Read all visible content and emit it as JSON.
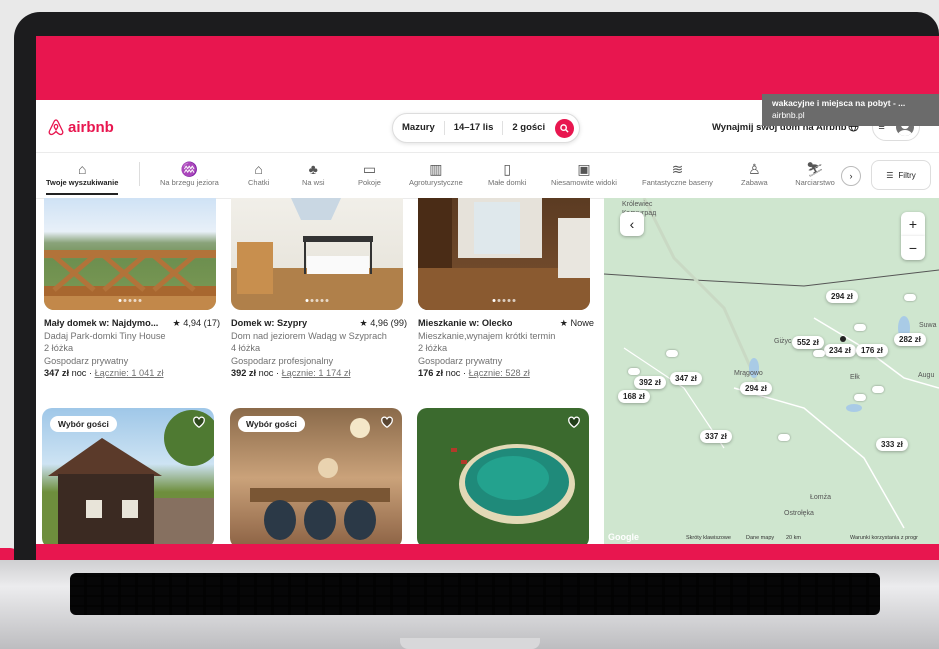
{
  "tooltip": {
    "line1": "wakacyjne i miejsca na pobyt - ...",
    "line2": "airbnb.pl"
  },
  "header": {
    "logo_text": "airbnb",
    "search": {
      "location": "Mazury",
      "dates": "14–17 lis",
      "guests": "2 gości"
    },
    "host_link": "Wynajmij swój dom na Airbnb"
  },
  "categories": [
    {
      "label": "Twoje wyszukiwanie",
      "icon": "home-search-icon",
      "active": true
    },
    {
      "label": "Na brzegu jeziora",
      "icon": "lake-icon"
    },
    {
      "label": "Chatki",
      "icon": "cabin-icon"
    },
    {
      "label": "Na wsi",
      "icon": "countryside-icon"
    },
    {
      "label": "Pokoje",
      "icon": "bed-icon"
    },
    {
      "label": "Agroturystyczne",
      "icon": "farm-icon"
    },
    {
      "label": "Małe domki",
      "icon": "tiny-home-icon"
    },
    {
      "label": "Niesamowite widoki",
      "icon": "view-icon"
    },
    {
      "label": "Fantastyczne baseny",
      "icon": "pool-icon"
    },
    {
      "label": "Zabawa",
      "icon": "play-icon"
    },
    {
      "label": "Narciarstwo",
      "icon": "ski-icon"
    }
  ],
  "filters_label": "Filtry",
  "listings": [
    {
      "title": "Mały domek w: Najdymo...",
      "rating": "★ 4,94 (17)",
      "line1": "Dadaj Park-domki Tiny House",
      "line2": "2 łóżka",
      "line3": "Gospodarz prywatny",
      "price": "347 zł",
      "price_suffix": " noc · ",
      "total": "Łącznie: 1 041 zł"
    },
    {
      "title": "Domek w: Szypry",
      "rating": "★ 4,96 (99)",
      "line1": "Dom nad jeziorem Wadąg w Szyprach",
      "line2": "4 łóżka",
      "line3": "Gospodarz profesjonalny",
      "price": "392 zł",
      "price_suffix": " noc · ",
      "total": "Łącznie: 1 174 zł"
    },
    {
      "title": "Mieszkanie w: Olecko",
      "rating": "★ Nowe",
      "line1": "Mieszkanie,wynajem krótki termin",
      "line2": "2 łóżka",
      "line3": "Gospodarz prywatny",
      "price": "176 zł",
      "price_suffix": " noc · ",
      "total": "Łącznie: 528 zł"
    },
    {
      "badge": "Wybór gości"
    },
    {
      "badge": "Wybór gości"
    },
    {}
  ],
  "map": {
    "labels": {
      "top": "Królewiec",
      "top2": "Калинград",
      "gizycko": "Giżyc",
      "mragowo": "Mrągowo",
      "elk": "Ełk",
      "lomza": "Łomża",
      "ostroleka": "Ostrołęka",
      "suw": "Suwa",
      "aug": "Augu"
    },
    "prices": [
      "294 zł",
      "552 zł",
      "234 zł",
      "176 zł",
      "282 zł",
      "392 zł",
      "347 zł",
      "168 zł",
      "294 zł",
      "337 zł",
      "333 zł"
    ],
    "footer": {
      "google": "Google",
      "shortcuts": "Skróty klawiszowe",
      "data": "Dane mapy",
      "scale": "20 km",
      "terms": "Warunki korzystania z progr"
    }
  }
}
